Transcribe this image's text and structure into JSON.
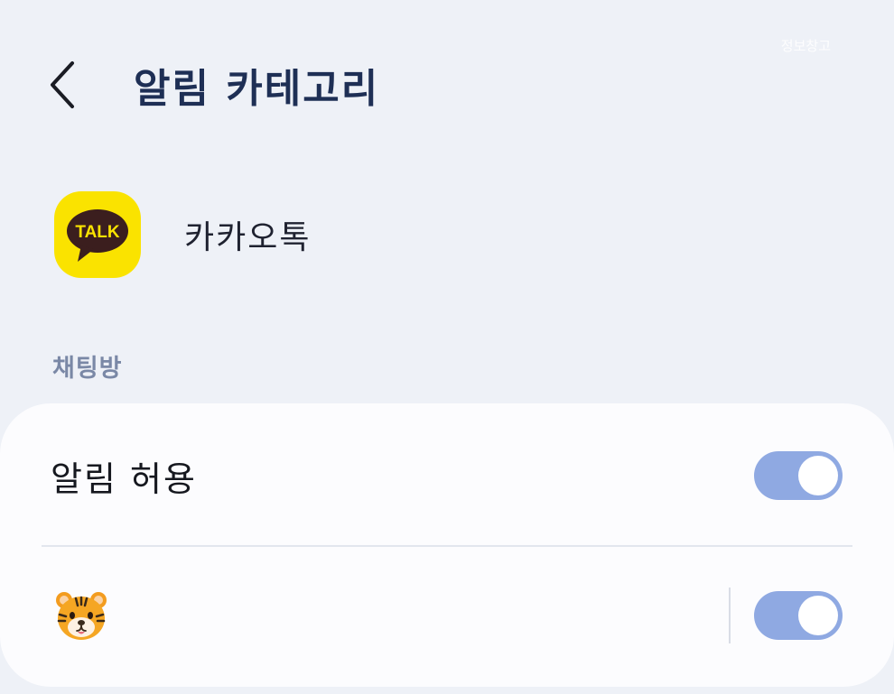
{
  "watermark": "정보창고",
  "header": {
    "title": "알림 카테고리",
    "back_icon": "chevron-left-icon"
  },
  "app": {
    "name": "카카오톡",
    "icon_label": "TALK",
    "icon_name": "kakaotalk-logo",
    "icon_color": "#fae300",
    "bubble_color": "#3b1e1e"
  },
  "section": {
    "label": "채팅방"
  },
  "settings": [
    {
      "label": "알림 허용",
      "toggle_on": true
    },
    {
      "icon": "tiger-face-icon",
      "toggle_on": true
    }
  ],
  "colors": {
    "toggle_on": "#8fa9e2",
    "title": "#1e2f55",
    "section_label": "#7a88a6"
  }
}
